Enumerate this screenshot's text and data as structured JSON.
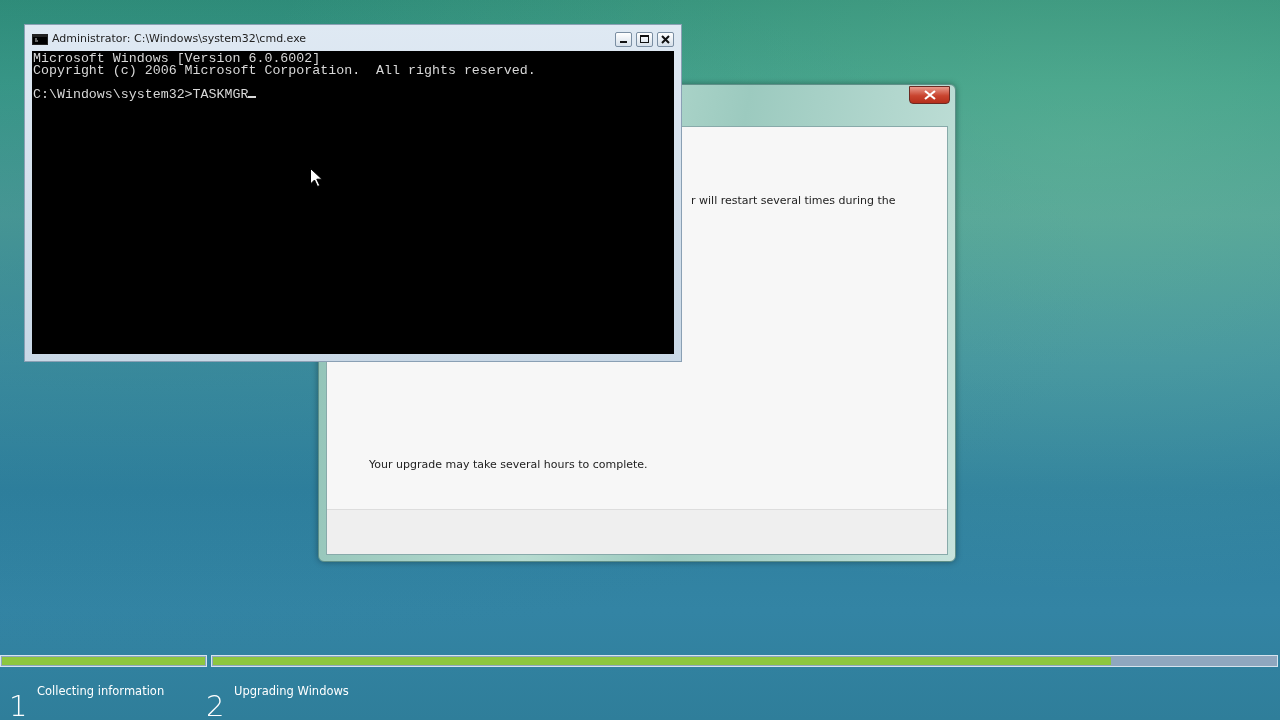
{
  "cmd_window": {
    "title": "Administrator: C:\\Windows\\system32\\cmd.exe",
    "output": [
      "Microsoft Windows [Version 6.0.6002]",
      "Copyright (c) 2006 Microsoft Corporation.  All rights reserved."
    ],
    "prompt": "C:\\Windows\\system32>TASKMGR"
  },
  "setup_window": {
    "message": "r will restart several times during the",
    "note": "Your upgrade may take several hours to complete."
  },
  "steps": [
    {
      "number": "1",
      "label": "Collecting information",
      "level": 1
    },
    {
      "number": "2",
      "label": "Upgrading Windows",
      "level": 0.845
    }
  ]
}
